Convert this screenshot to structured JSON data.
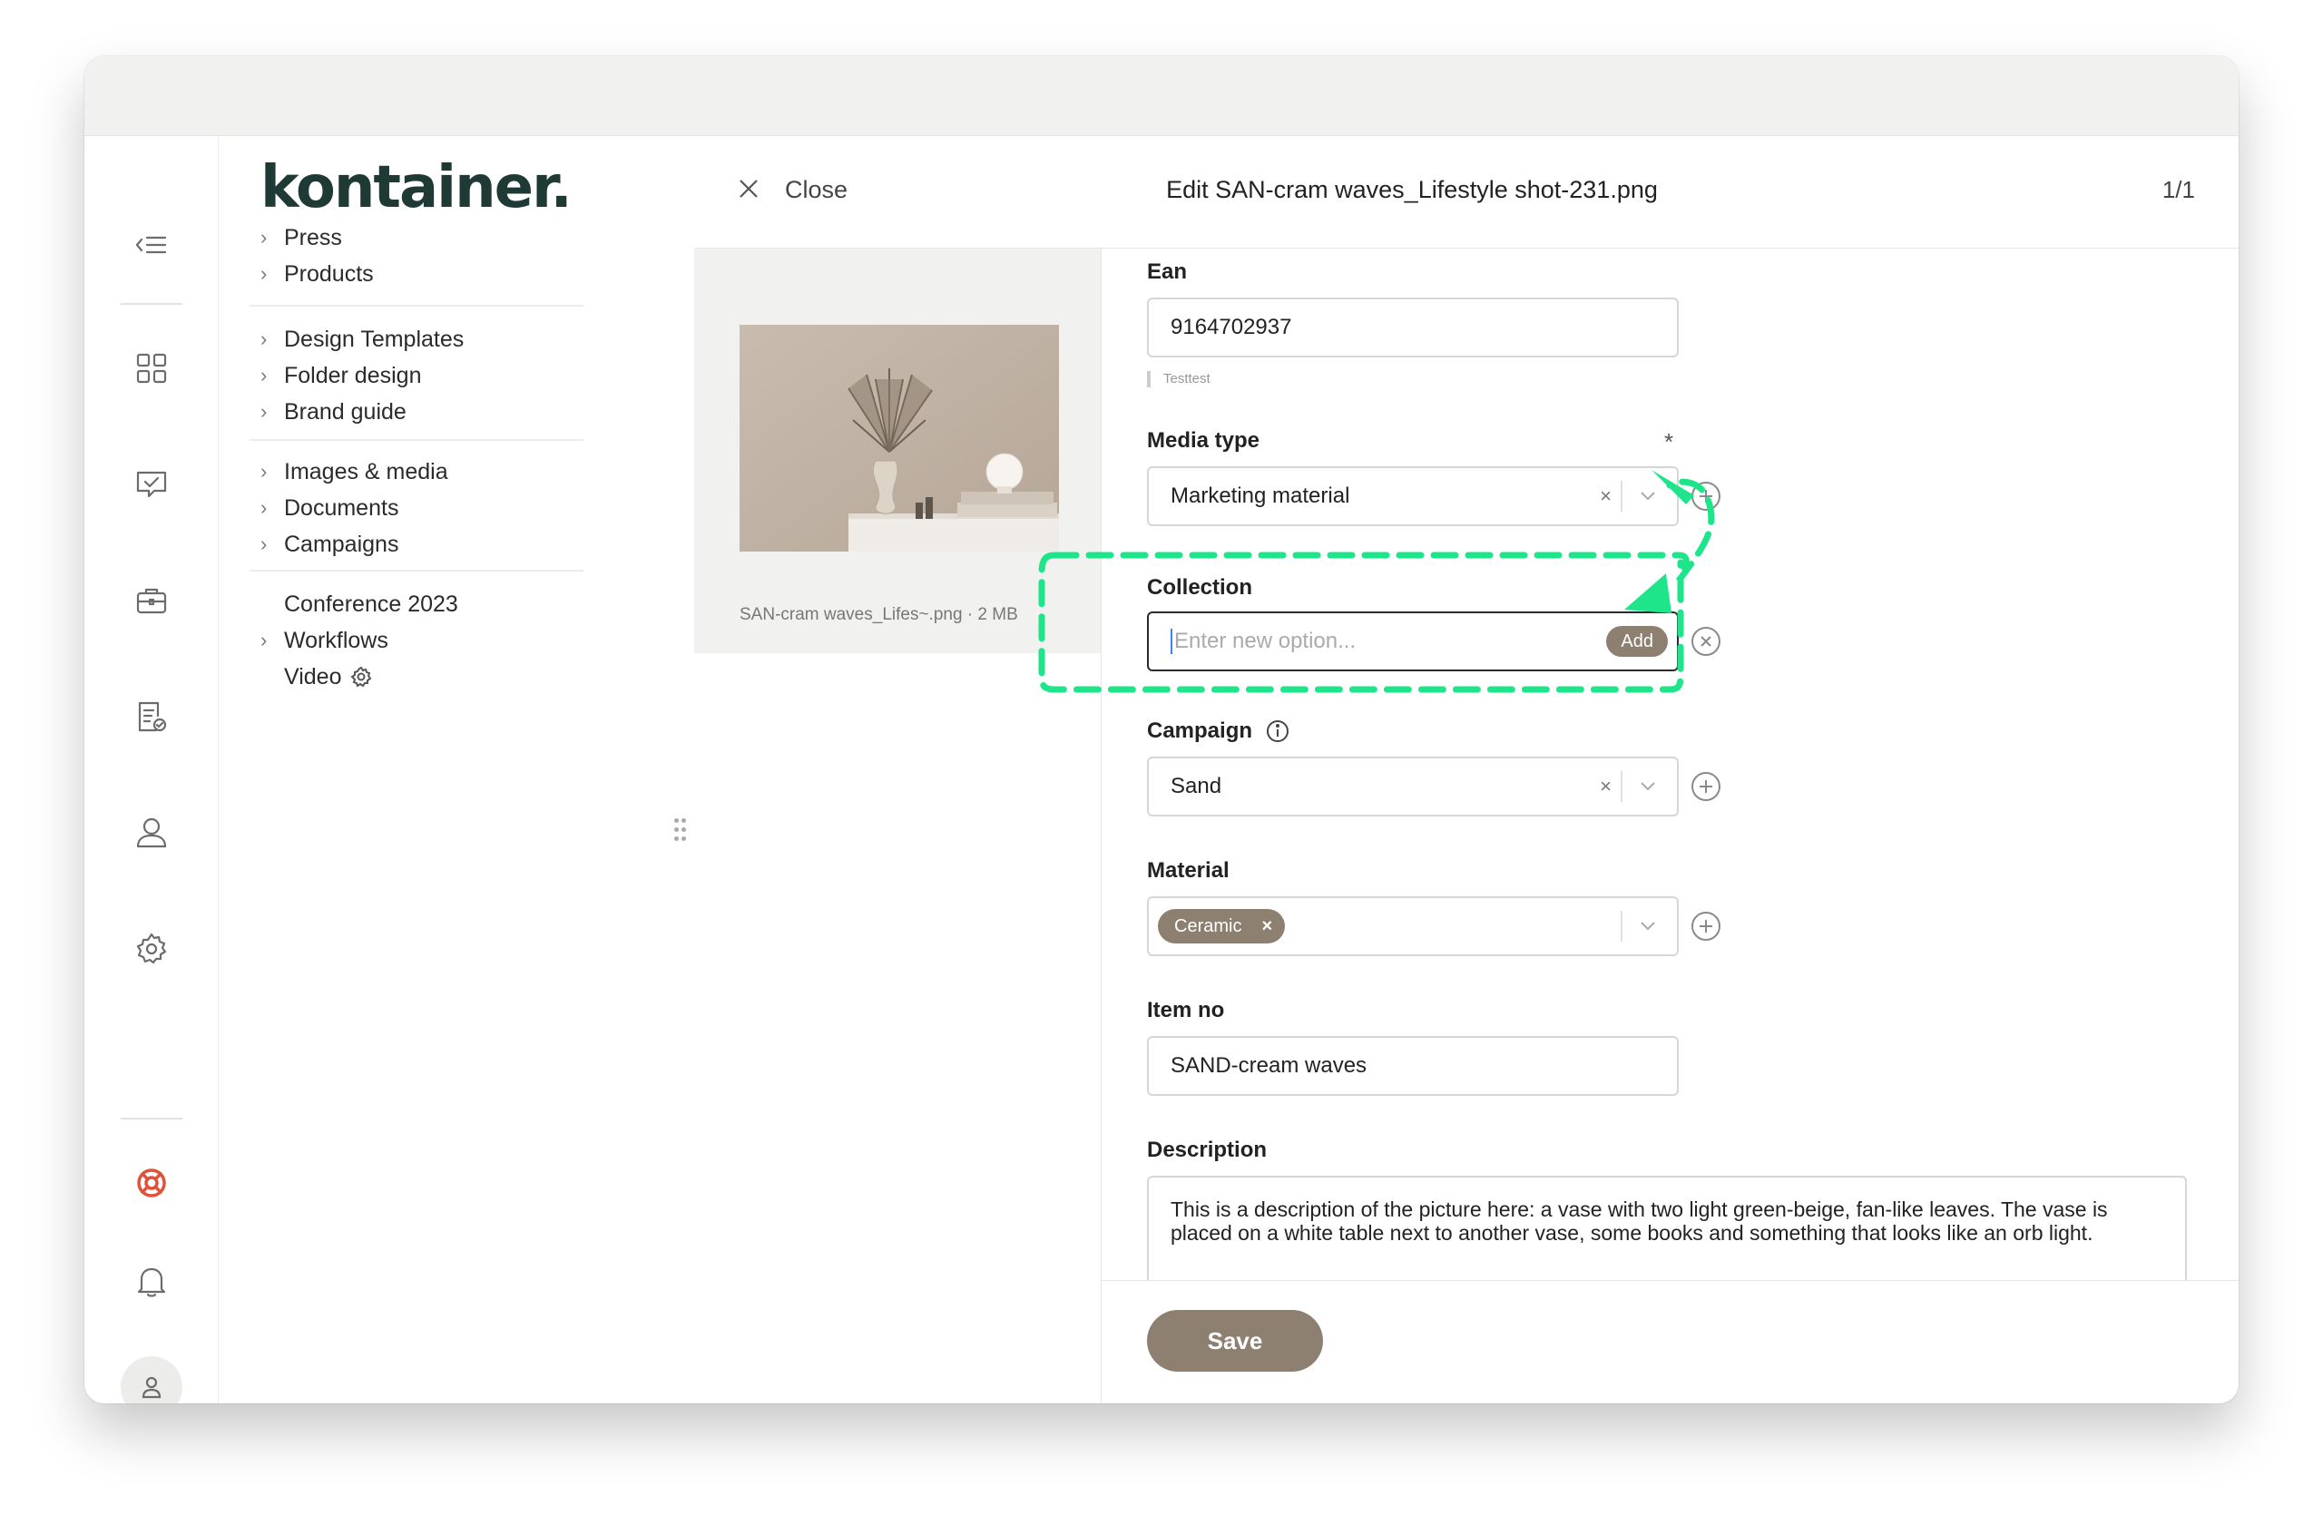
{
  "brand": {
    "logo_text": "kontainer."
  },
  "header": {
    "close_label": "Close",
    "title": "Edit SAN-cram waves_Lifestyle shot-231.png",
    "counter": "1/1"
  },
  "nav": {
    "group1": [
      {
        "label": "Press",
        "has_children": true
      },
      {
        "label": "Products",
        "has_children": true
      }
    ],
    "group2": [
      {
        "label": "Design Templates",
        "has_children": true
      },
      {
        "label": "Folder design",
        "has_children": true
      },
      {
        "label": "Brand guide",
        "has_children": true
      }
    ],
    "group3": [
      {
        "label": "Images & media",
        "has_children": true
      },
      {
        "label": "Documents",
        "has_children": true
      },
      {
        "label": "Campaigns",
        "has_children": true
      }
    ],
    "group4": [
      {
        "label": "Conference 2023",
        "has_children": false
      },
      {
        "label": "Workflows",
        "has_children": true
      },
      {
        "label": "Video",
        "has_children": false,
        "icon": "gear-icon"
      }
    ]
  },
  "rail": {
    "icons": [
      "collapse-menu-icon",
      "grid-icon",
      "chat-check-icon",
      "briefcase-icon",
      "document-check-icon",
      "user-icon",
      "settings-icon",
      "help-lifebuoy-icon",
      "bell-icon",
      "account-avatar-icon"
    ]
  },
  "preview": {
    "caption": "SAN-cram waves_Lifes~.png · 2 MB"
  },
  "form": {
    "ean": {
      "label": "Ean",
      "value": "9164702937",
      "hint": "Testtest"
    },
    "media_type": {
      "label": "Media type",
      "required_mark": "*",
      "value": "Marketing material",
      "clear": "×"
    },
    "collection": {
      "label": "Collection",
      "placeholder": "Enter new option...",
      "add_label": "Add"
    },
    "campaign": {
      "label": "Campaign",
      "value": "Sand",
      "clear": "×"
    },
    "material": {
      "label": "Material",
      "tags": [
        "Ceramic"
      ],
      "tag_remove": "×"
    },
    "item_no": {
      "label": "Item no",
      "value": "SAND-cream waves"
    },
    "description": {
      "label": "Description",
      "value": "This is a description of the picture here: a vase with two light green-beige, fan-like leaves. The vase is placed on a white table next to another vase, some books and something that looks like an orb light."
    }
  },
  "footer": {
    "save_label": "Save"
  },
  "colors": {
    "accent": "#8d8070",
    "annotation": "#1ee58a",
    "logo": "#1f3a35",
    "help_icon": "#e0523a"
  }
}
